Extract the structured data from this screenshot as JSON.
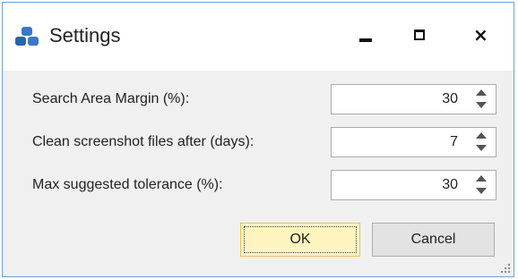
{
  "window": {
    "title": "Settings",
    "controls": {
      "minimize": "minimize",
      "maximize": "maximize",
      "close": "×"
    },
    "icon": "settings-app-icon",
    "accent_color": "#4a7fc1"
  },
  "settings": [
    {
      "label": "Search Area Margin (%):",
      "value": "30"
    },
    {
      "label": "Clean screenshot files after (days):",
      "value": "7"
    },
    {
      "label": "Max suggested tolerance (%):",
      "value": "30"
    }
  ],
  "buttons": {
    "ok_label": "OK",
    "cancel_label": "Cancel"
  }
}
